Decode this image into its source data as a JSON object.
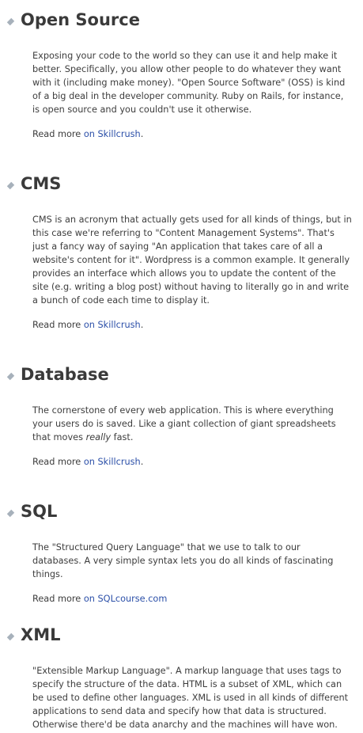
{
  "terms": [
    {
      "title": "Open Source",
      "description": "Exposing your code to the world so they can use it and help make it better. Specifically, you allow other people to do whatever they want with it (including make money). \"Open Source Software\" (OSS) is kind of a big deal in the developer community. Ruby on Rails, for instance, is open source and you couldn't use it otherwise.",
      "read_more_prefix": "Read more ",
      "read_more_link": "on Skillcrush",
      "read_more_suffix": "."
    },
    {
      "title": "CMS",
      "description": "CMS is an acronym that actually gets used for all kinds of things, but in this case we're referring to \"Content Management Systems\". That's just a fancy way of saying \"An application that takes care of all a website's content for it\". Wordpress is a common example. It generally provides an interface which allows you to update the content of the site (e.g. writing a blog post) without having to literally go in and write a bunch of code each time to display it.",
      "read_more_prefix": "Read more ",
      "read_more_link": "on Skillcrush",
      "read_more_suffix": "."
    },
    {
      "title": "Database",
      "description_before": "The cornerstone of every web application. This is where everything your users do is saved. Like a giant collection of giant spreadsheets that moves ",
      "description_emphasis": "really",
      "description_after": " fast.",
      "read_more_prefix": "Read more ",
      "read_more_link": "on Skillcrush",
      "read_more_suffix": "."
    },
    {
      "title": "SQL",
      "description": "The \"Structured Query Language\" that we use to talk to our databases. A very simple syntax lets you do all kinds of fascinating things.",
      "read_more_prefix": "Read more ",
      "read_more_link": "on SQLcourse.com",
      "read_more_suffix": ""
    },
    {
      "title": "XML",
      "description": "\"Extensible Markup Language\". A markup language that uses tags to specify the structure of the data. HTML is a subset of XML, which can be used to define other languages. XML is used in all kinds of different applications to send data and specify how that data is structured. Otherwise there'd be data anarchy and the machines will have won."
    }
  ]
}
